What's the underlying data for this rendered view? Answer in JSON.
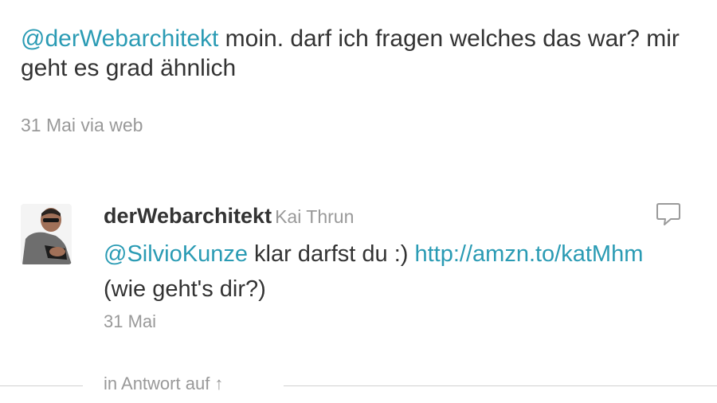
{
  "theme": {
    "accent": "#2a9bb4",
    "text": "#333333",
    "muted": "#999999"
  },
  "main_tweet": {
    "mention": "@derWebarchitekt",
    "text": " moin. darf ich fragen welches das war? mir geht es grad ähnlich",
    "meta": "31 Mai via web"
  },
  "reply_tweet": {
    "avatar_icon": "user-avatar-photo",
    "screen_name": "derWebarchitekt",
    "real_name": "Kai Thrun",
    "mention": "@SilvioKunze",
    "text_middle": " klar darfst du :) ",
    "link": "http://amzn.to/katMhm",
    "text_end": " (wie geht's dir?)",
    "date": "31 Mai",
    "reply_icon": "speech-bubble-icon"
  },
  "thread": {
    "in_reply_label": "in Antwort auf ↑"
  }
}
